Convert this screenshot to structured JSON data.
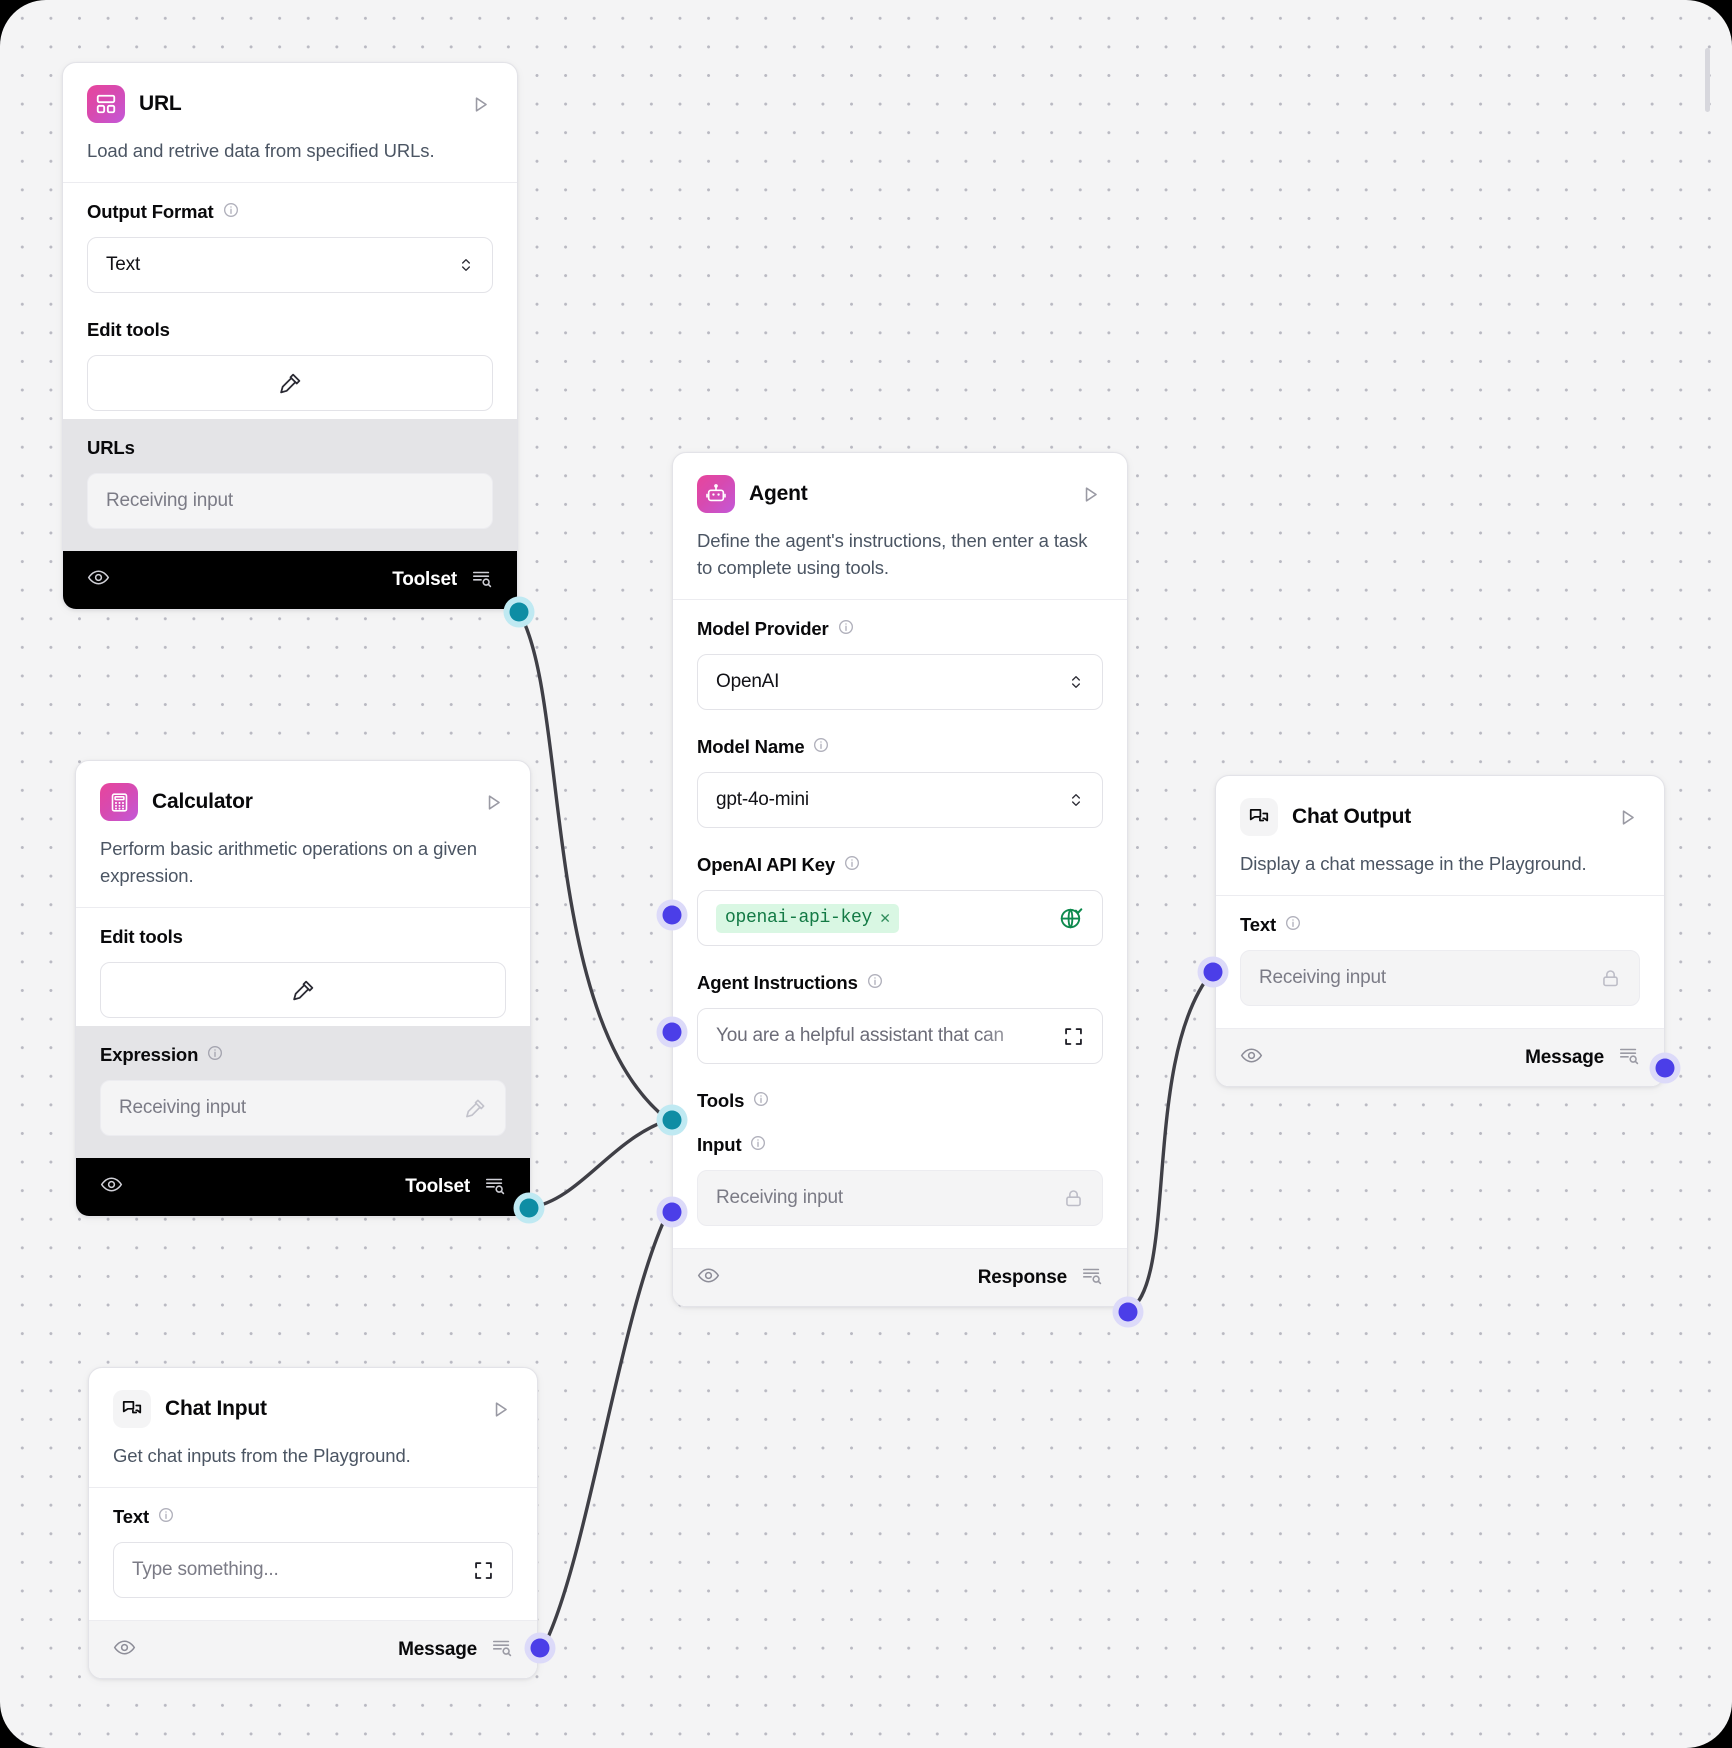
{
  "canvas": {
    "background": "#f4f4f5",
    "dot_color": "#b9b9c2",
    "frame_color": "#000000"
  },
  "palette": {
    "node_accent_gradient_start": "#e8459b",
    "node_accent_gradient_end": "#c358d8",
    "output_port_teal": "#0e8da4",
    "input_port_blue": "#4b3ee8",
    "toolset_footer_bg": "#000000",
    "api_key_pill_bg": "#d9f7e3",
    "api_key_pill_text": "#137a45"
  },
  "nodes": [
    {
      "id": "url",
      "title": "URL",
      "icon": "layout-dashboard-icon",
      "description": "Load and retrive data from specified URLs.",
      "fields": [
        {
          "label": "Output Format",
          "info": true,
          "type": "select",
          "value": "Text"
        },
        {
          "label": "Edit tools",
          "info": false,
          "type": "button",
          "value": "",
          "icon": "hammer-icon"
        },
        {
          "label": "URLs",
          "info": false,
          "type": "input",
          "placeholder": "Receiving input",
          "shaded": true
        }
      ],
      "footer": {
        "label": "Toolset",
        "style": "dark",
        "eye_icon": "eye-icon",
        "list_icon": "list-search-icon"
      }
    },
    {
      "id": "calculator",
      "title": "Calculator",
      "icon": "calculator-icon",
      "description": "Perform basic arithmetic operations on a given expression.",
      "fields": [
        {
          "label": "Edit tools",
          "info": false,
          "type": "button",
          "value": "",
          "icon": "hammer-icon"
        },
        {
          "label": "Expression",
          "info": true,
          "type": "input",
          "placeholder": "Receiving input",
          "shaded": true,
          "trailing_icon": "hammer-icon"
        }
      ],
      "footer": {
        "label": "Toolset",
        "style": "dark",
        "eye_icon": "eye-icon",
        "list_icon": "list-search-icon"
      }
    },
    {
      "id": "agent",
      "title": "Agent",
      "icon": "robot-icon",
      "description": "Define the agent's instructions, then enter a task to complete using tools.",
      "fields": [
        {
          "label": "Model Provider",
          "info": true,
          "type": "select",
          "value": "OpenAI"
        },
        {
          "label": "Model Name",
          "info": true,
          "type": "select",
          "value": "gpt-4o-mini"
        },
        {
          "label": "OpenAI API Key",
          "info": true,
          "type": "apikey",
          "value": "openai-api-key",
          "trailing_icon": "globe-check-icon"
        },
        {
          "label": "Agent Instructions",
          "info": true,
          "type": "input",
          "placeholder": "You are a helpful assistant that can",
          "trailing_icon": "expand-icon"
        },
        {
          "label": "Tools",
          "info": true,
          "type": "porthandle-only"
        },
        {
          "label": "Input",
          "info": true,
          "type": "input",
          "placeholder": "Receiving input",
          "muted": true,
          "trailing_icon": "lock-icon"
        }
      ],
      "footer": {
        "label": "Response",
        "style": "light",
        "eye_icon": "eye-icon",
        "list_icon": "list-search-icon"
      }
    },
    {
      "id": "chat-output",
      "title": "Chat Output",
      "icon": "chat-bubbles-icon",
      "description": "Display a chat message in the Playground.",
      "fields": [
        {
          "label": "Text",
          "info": true,
          "type": "input",
          "placeholder": "Receiving input",
          "muted": true,
          "trailing_icon": "lock-icon"
        }
      ],
      "footer": {
        "label": "Message",
        "style": "light",
        "eye_icon": "eye-icon",
        "list_icon": "list-search-icon"
      }
    },
    {
      "id": "chat-input",
      "title": "Chat Input",
      "icon": "chat-bubbles-icon",
      "description": "Get chat inputs from the Playground.",
      "fields": [
        {
          "label": "Text",
          "info": true,
          "type": "input",
          "placeholder": "Type something...",
          "trailing_icon": "expand-icon"
        }
      ],
      "footer": {
        "label": "Message",
        "style": "light",
        "eye_icon": "eye-icon",
        "list_icon": "list-search-icon"
      }
    }
  ],
  "connections": [
    {
      "from": "url.toolset",
      "to": "agent.tools"
    },
    {
      "from": "calculator.toolset",
      "to": "agent.tools"
    },
    {
      "from": "chat-input.message",
      "to": "agent.input"
    },
    {
      "from": "agent.response",
      "to": "chat-output.text"
    }
  ]
}
